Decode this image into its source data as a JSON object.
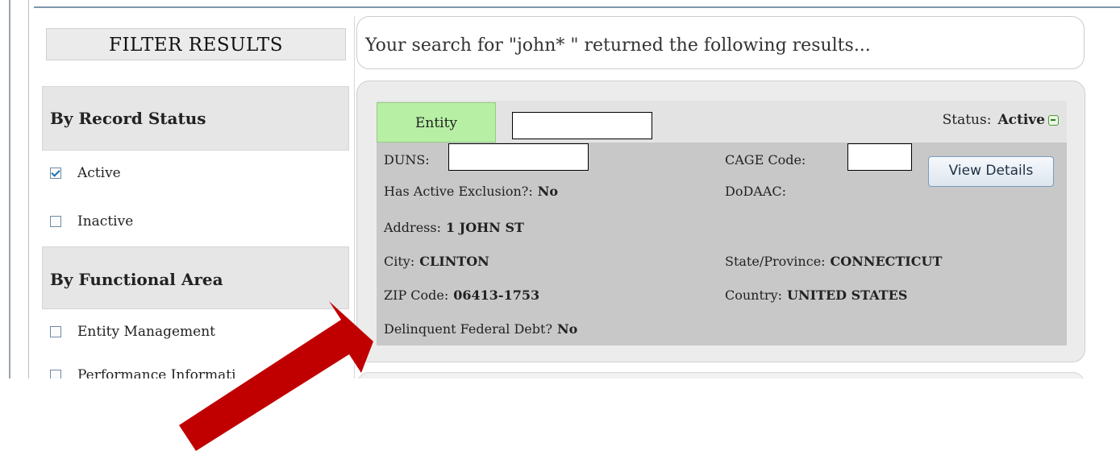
{
  "sidebar": {
    "title": "FILTER RESULTS",
    "record_status": {
      "heading": "By Record Status",
      "options": [
        {
          "label": "Active",
          "checked": true
        },
        {
          "label": "Inactive",
          "checked": false
        }
      ]
    },
    "functional_area": {
      "heading": "By Functional Area",
      "options": [
        {
          "label": "Entity Management",
          "checked": false
        },
        {
          "label": "Performance Informati",
          "checked": false
        }
      ]
    }
  },
  "search": {
    "message": "Your search for \"john* \" returned the following results..."
  },
  "result": {
    "type_label": "Entity",
    "status_label": "Status:",
    "status_value": "Active",
    "duns_label": "DUNS:",
    "cage_label": "CAGE Code:",
    "exclusion_label": "Has Active Exclusion?:",
    "exclusion_value": "No",
    "dodaac_label": "DoDAAC:",
    "address_label": "Address:",
    "address_value": "1 JOHN ST",
    "city_label": "City:",
    "city_value": "CLINTON",
    "state_label": "State/Province:",
    "state_value": "CONNECTICUT",
    "zip_label": "ZIP Code:",
    "zip_value": "06413-1753",
    "country_label": "Country:",
    "country_value": "UNITED STATES",
    "debt_label": "Delinquent Federal Debt?",
    "debt_value": "No",
    "view_details_label": "View Details"
  },
  "annotation": {
    "arrow_color": "#c00000"
  }
}
